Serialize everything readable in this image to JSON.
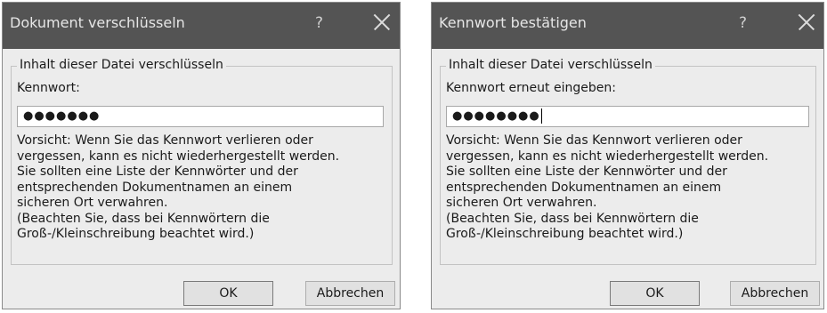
{
  "dialog1": {
    "title": "Dokument verschlüsseln",
    "help_glyph": "?",
    "group_label": "Inhalt dieser Datei verschlüsseln",
    "field_label": "Kennwort:",
    "password_masked": "●●●●●●●",
    "warning": "Vorsicht: Wenn Sie das Kennwort verlieren oder\nvergessen, kann es nicht wiederhergestellt werden.\nSie sollten eine Liste der Kennwörter und der\nentsprechenden Dokumentnamen an einem\nsicheren Ort verwahren.\n(Beachten Sie, dass bei Kennwörtern die\nGroß-/Kleinschreibung beachtet wird.)",
    "ok_label": "OK",
    "cancel_label": "Abbrechen"
  },
  "dialog2": {
    "title": "Kennwort bestätigen",
    "help_glyph": "?",
    "group_label": "Inhalt dieser Datei verschlüsseln",
    "field_label": "Kennwort erneut eingeben:",
    "password_masked": "●●●●●●●●",
    "warning": "Vorsicht: Wenn Sie das Kennwort verlieren oder\nvergessen, kann es nicht wiederhergestellt werden.\nSie sollten eine Liste der Kennwörter und der\nentsprechenden Dokumentnamen an einem\nsicheren Ort verwahren.\n(Beachten Sie, dass bei Kennwörtern die\nGroß-/Kleinschreibung beachtet wird.)",
    "ok_label": "OK",
    "cancel_label": "Abbrechen"
  }
}
